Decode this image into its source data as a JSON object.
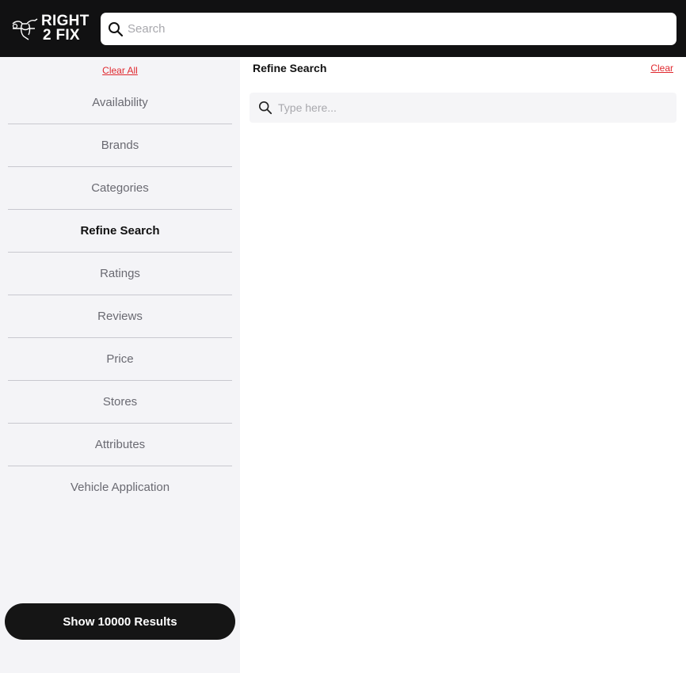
{
  "header": {
    "logo_line1": "RIGHT",
    "logo_line2": "2 FIX",
    "search_placeholder": "Search"
  },
  "sidebar": {
    "clear_all": "Clear All",
    "facets": [
      {
        "label": "Availability",
        "active": false
      },
      {
        "label": "Brands",
        "active": false
      },
      {
        "label": "Categories",
        "active": false
      },
      {
        "label": "Refine Search",
        "active": true
      },
      {
        "label": "Ratings",
        "active": false
      },
      {
        "label": "Reviews",
        "active": false
      },
      {
        "label": "Price",
        "active": false
      },
      {
        "label": "Stores",
        "active": false
      },
      {
        "label": "Attributes",
        "active": false
      },
      {
        "label": "Vehicle Application",
        "active": false
      }
    ],
    "show_results": "Show 10000 Results"
  },
  "panel": {
    "title": "Refine Search",
    "clear": "Clear",
    "input_placeholder": "Type here..."
  },
  "icons": {
    "logo": "wrench-hand-icon",
    "search": "search-icon"
  },
  "colors": {
    "header_bg": "#111112",
    "sidebar_bg": "#f4f4f7",
    "accent_red": "#e0282e",
    "button_bg": "#151515"
  }
}
